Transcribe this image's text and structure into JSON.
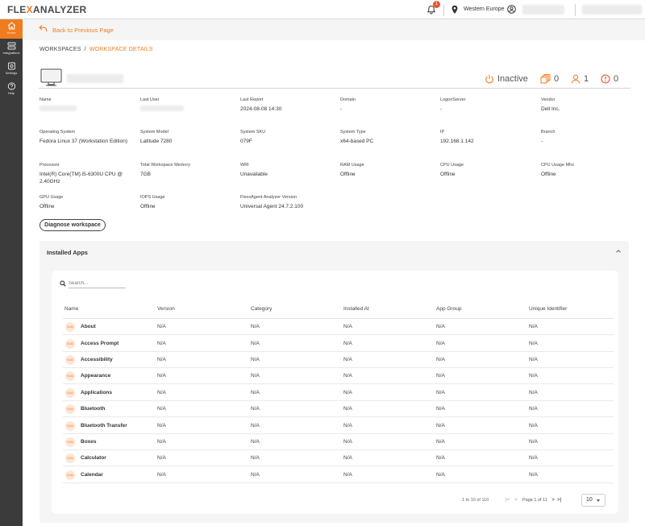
{
  "app": {
    "logo_prefix": "FLE",
    "logo_x": "X",
    "logo_suffix": "ANALYZER"
  },
  "topbar": {
    "notification_count": "1",
    "region": "Western Europe"
  },
  "sidebar": {
    "items": [
      {
        "label": "Home",
        "icon": "home-icon",
        "active": true
      },
      {
        "label": "Integrations",
        "icon": "integrations-icon",
        "active": false
      },
      {
        "label": "Settings",
        "icon": "settings-icon",
        "active": false
      },
      {
        "label": "Help",
        "icon": "help-icon",
        "active": false
      }
    ]
  },
  "nav": {
    "back_label": "Back to Previous Page"
  },
  "breadcrumb": {
    "root": "WORKSPACES",
    "separator": "/",
    "current": "WORKSPACE DETAILS"
  },
  "workspace": {
    "status": "Inactive",
    "sessions": "0",
    "users": "1",
    "alerts": "0"
  },
  "details": [
    {
      "label": "Name",
      "value": ""
    },
    {
      "label": "Last User",
      "value": ""
    },
    {
      "label": "Last Report",
      "value": "2024-08-08 14:30"
    },
    {
      "label": "Domain",
      "value": "-"
    },
    {
      "label": "LogonServer",
      "value": "-"
    },
    {
      "label": "Vendor",
      "value": "Dell Inc."
    },
    {
      "label": "Operating System",
      "value": "Fedora Linux 37 (Workstation Edition)"
    },
    {
      "label": "System Model",
      "value": "Latitude 7280"
    },
    {
      "label": "System SKU",
      "value": "079F"
    },
    {
      "label": "System Type",
      "value": "x64-based PC"
    },
    {
      "label": "IP",
      "value": "192.168.1.142"
    },
    {
      "label": "Branch",
      "value": "-"
    },
    {
      "label": "Processor",
      "value": "Intel(R) Core(TM) i5-6300U CPU @ 2.40GHz"
    },
    {
      "label": "Total Workspace Memory",
      "value": "7GB"
    },
    {
      "label": "WRI",
      "value": "Unavailable"
    },
    {
      "label": "RAM Usage",
      "value": "Offline"
    },
    {
      "label": "CPU Usage",
      "value": "Offline"
    },
    {
      "label": "CPU Usage Mhz",
      "value": "Offline"
    },
    {
      "label": "GPU Usage",
      "value": "Offline"
    },
    {
      "label": "IOPS Usage",
      "value": "Offline"
    },
    {
      "label": "FlexxAgent Analyzer Version",
      "value": "Universal Agent 24.7.2.100"
    }
  ],
  "actions": {
    "diagnose_label": "Diagnose workspace"
  },
  "installed_apps": {
    "title": "Installed Apps",
    "search_placeholder": "Search...",
    "columns": [
      "Name",
      "Version",
      "Category",
      "Installed At",
      "App Group",
      "Unique Identifier"
    ],
    "icon_text": "SUM",
    "rows": [
      {
        "name": "About",
        "version": "N/A",
        "category": "N/A",
        "installed_at": "N/A",
        "app_group": "N/A",
        "uid": "N/A"
      },
      {
        "name": "Access Prompt",
        "version": "N/A",
        "category": "N/A",
        "installed_at": "N/A",
        "app_group": "N/A",
        "uid": "N/A"
      },
      {
        "name": "Accessibility",
        "version": "N/A",
        "category": "N/A",
        "installed_at": "N/A",
        "app_group": "N/A",
        "uid": "N/A"
      },
      {
        "name": "Appearance",
        "version": "N/A",
        "category": "N/A",
        "installed_at": "N/A",
        "app_group": "N/A",
        "uid": "N/A"
      },
      {
        "name": "Applications",
        "version": "N/A",
        "category": "N/A",
        "installed_at": "N/A",
        "app_group": "N/A",
        "uid": "N/A"
      },
      {
        "name": "Bluetooth",
        "version": "N/A",
        "category": "N/A",
        "installed_at": "N/A",
        "app_group": "N/A",
        "uid": "N/A"
      },
      {
        "name": "Bluetooth Transfer",
        "version": "N/A",
        "category": "N/A",
        "installed_at": "N/A",
        "app_group": "N/A",
        "uid": "N/A"
      },
      {
        "name": "Boxes",
        "version": "N/A",
        "category": "N/A",
        "installed_at": "N/A",
        "app_group": "N/A",
        "uid": "N/A"
      },
      {
        "name": "Calculator",
        "version": "N/A",
        "category": "N/A",
        "installed_at": "N/A",
        "app_group": "N/A",
        "uid": "N/A"
      },
      {
        "name": "Calendar",
        "version": "N/A",
        "category": "N/A",
        "installed_at": "N/A",
        "app_group": "N/A",
        "uid": "N/A"
      }
    ],
    "pagination": {
      "range": "1 to 10 of 110",
      "page_text": "Page 1 of 11",
      "page_size": "10"
    }
  },
  "colors": {
    "accent": "#f07c20",
    "sidebar": "#3b3b3b",
    "panel": "#f5f5f5"
  }
}
